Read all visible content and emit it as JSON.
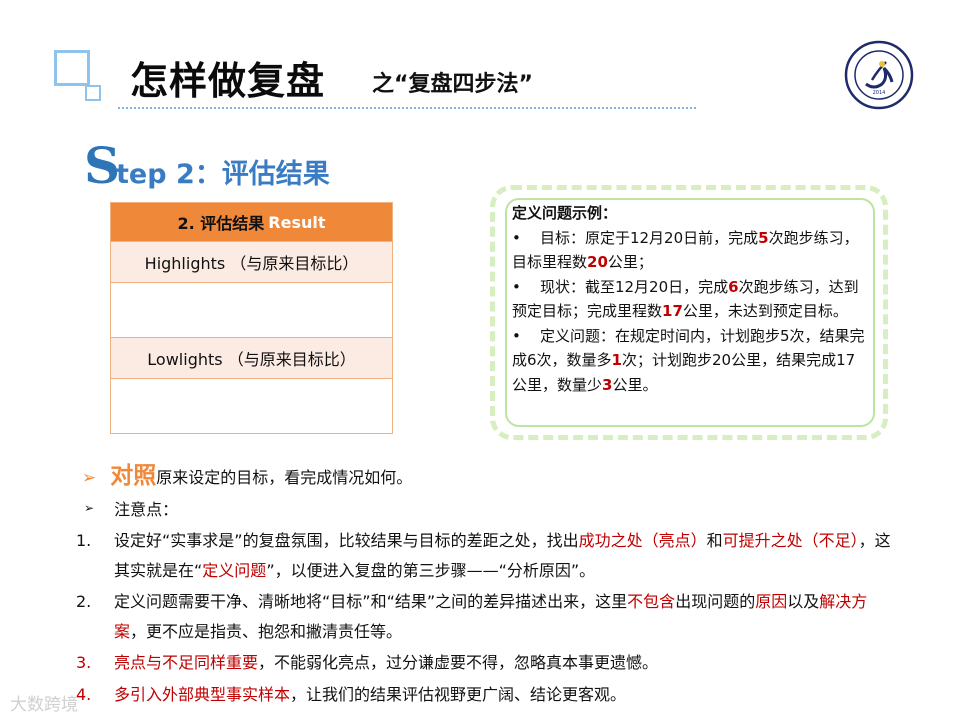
{
  "header": {
    "title": "怎样做复盘",
    "subtitle": "之“复盘四步法”"
  },
  "logo": {
    "ring_text": "LEIDABSON UNIVERSITY",
    "year": "2014",
    "ring_color": "#1f2a6b"
  },
  "step": {
    "letter": "S",
    "rest": "tep 2：",
    "label": "评估结果"
  },
  "table": {
    "header_cn": "2.  评估结果",
    "header_en": "Result",
    "highlights": "Highlights （与原来目标比）",
    "lowlights": "Lowlights （与原来目标比）"
  },
  "callout": {
    "heading": "定义问题示例：",
    "b1": {
      "bullet": "•",
      "t1": "目标：原定于12月20日前，完成",
      "n1": "5",
      "t2": "次跑步练习，目标里程数",
      "n2": "20",
      "t3": "公里；"
    },
    "b2": {
      "bullet": "•",
      "t1": "现状：截至12月20日，完成",
      "n1": "6",
      "t2": "次跑步练习，达到预定目标；完成里程数",
      "n2": "17",
      "t3": "公里，未达到预定目标。"
    },
    "b3": {
      "bullet": "•",
      "t1": "定义问题：在规定时间内，计划跑步5次，结果完成6次，数量多",
      "n1": "1",
      "t2": "次；计划跑步20公里，结果完成17公里，数量少",
      "n2": "3",
      "t3": "公里。"
    }
  },
  "points": {
    "p1_arrow": "➢",
    "p1_hl": "对照",
    "p1_text": "原来设定的目标，看完成情况如何。",
    "p2_arrow": "➢",
    "p2_text": "注意点："
  },
  "items": [
    {
      "num": "1.",
      "a": "设定好“实事求是”的复盘氛围，比较结果与目标的差距之处，找出",
      "b": "成功之处（亮点）",
      "c": "和",
      "d": "可提升之处（不足）",
      "e": "，这其实就是在“",
      "f": "定义问题",
      "g": "”，以便进入复盘的第三步骤——“分析原因”。"
    },
    {
      "num": "2.",
      "a": "定义问题需要干净、清晰地将“目标”和“结果”之间的差异描述出来，这里",
      "b": "不包含",
      "c": "出现问题的",
      "d": "原因",
      "e": "以及",
      "f": "解决方案",
      "g": "，更不应是指责、抱怨和撇清责任等。"
    },
    {
      "num": "3.",
      "a": "亮点与不足同样重要",
      "b": "，不能弱化亮点，过分谦虚要不得，忽略真本事更遗憾。"
    },
    {
      "num": "4.",
      "a": "多引入外部典型事实样本",
      "b": "，让我们的结果评估视野更广阔、结论更客观。"
    }
  ],
  "watermark": "大数跨境",
  "colors": {
    "accent_orange": "#f0883a",
    "emphasis_red": "#c00000",
    "step_blue": "#3a7cc4"
  }
}
